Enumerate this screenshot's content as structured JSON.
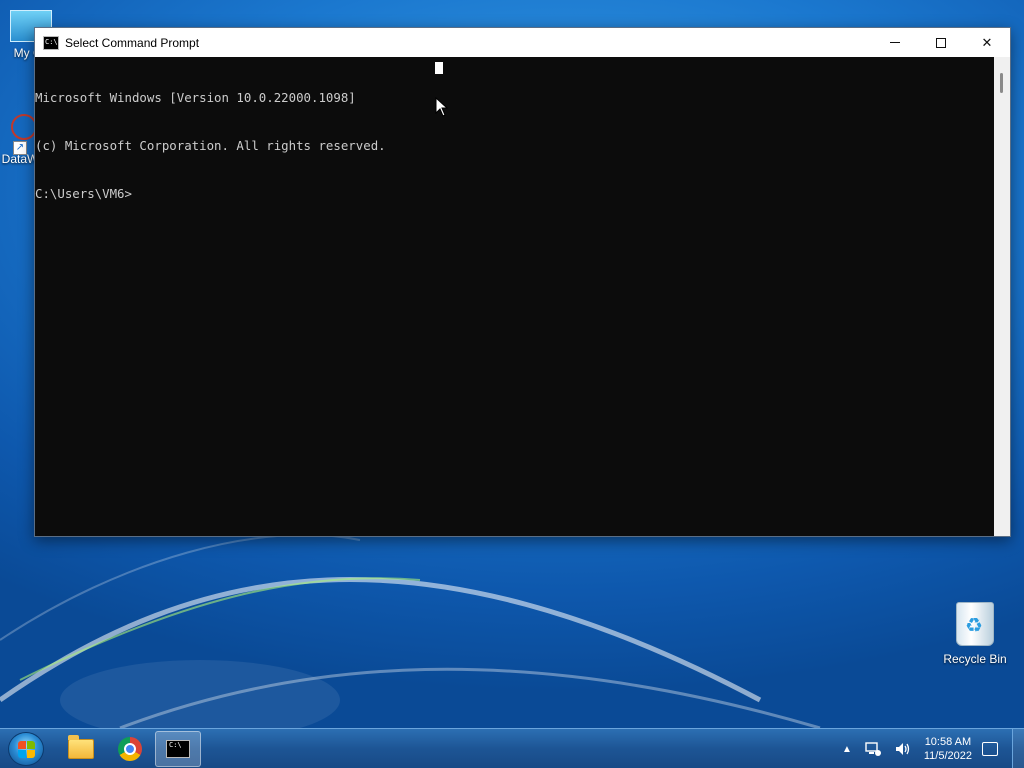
{
  "desktop": {
    "icons": [
      {
        "label": "My Co"
      },
      {
        "label": "DataW"
      },
      {
        "label": "Recycle Bin"
      }
    ]
  },
  "window": {
    "title": "Select Command Prompt",
    "controls": {
      "minimize": "minimize",
      "maximize": "maximize",
      "close": "✕"
    },
    "console_lines": [
      "Microsoft Windows [Version 10.0.22000.1098]",
      "(c) Microsoft Corporation. All rights reserved.",
      "C:\\Users\\VM6>"
    ]
  },
  "taskbar": {
    "items": [
      "start-button",
      "file-explorer",
      "google-chrome",
      "command-prompt"
    ],
    "tray": {
      "chevron": "▲",
      "time": "10:58 AM",
      "date": "11/5/2022"
    }
  },
  "colors": {
    "console_bg": "#0c0c0c",
    "console_text": "#cccccc",
    "taskbar": "#1d5595"
  }
}
